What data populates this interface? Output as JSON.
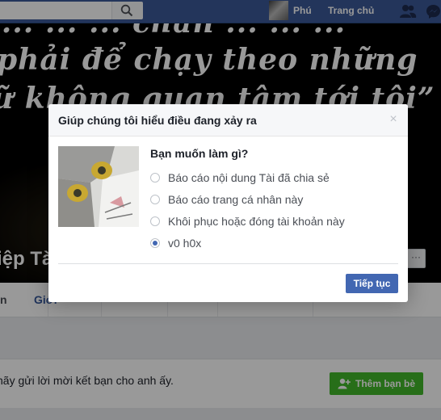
{
  "topbar": {
    "profile_name": "Phú",
    "home_label": "Trang chủ"
  },
  "cover": {
    "quote_line1": "“... ... ... chẳn ... ... ...”",
    "quote_line2": "phải để chạy theo những",
    "quote_line3": "ữ không quan tâm tới tôi”",
    "name": "iệp Tà"
  },
  "tabs": [
    "n",
    "Giới",
    "",
    "",
    ""
  ],
  "friend_panel": {
    "text": "hãy gửi lời mời kết bạn cho anh ấy.",
    "add_friend_label": "Thêm bạn bè"
  },
  "dialog": {
    "title": "Giúp chúng tôi hiểu điều đang xảy ra",
    "close_glyph": "×",
    "question": "Bạn muốn làm gì?",
    "options": [
      {
        "label": "Báo cáo nội dung Tài đã chia sẻ",
        "checked": false
      },
      {
        "label": "Báo cáo trang cá nhân này",
        "checked": false
      },
      {
        "label": "Khôi phục hoặc đóng tài khoản này",
        "checked": false
      },
      {
        "label": "v0 h0x",
        "checked": true
      }
    ],
    "continue_label": "Tiếp tục"
  },
  "colors": {
    "brand": "#3b5998",
    "primary_button": "#4267b2",
    "add_friend_button": "#42b72a"
  },
  "icons": [
    "search-icon",
    "friends-icon",
    "messages-icon",
    "add-friend-icon",
    "close-icon",
    "more-icon"
  ]
}
